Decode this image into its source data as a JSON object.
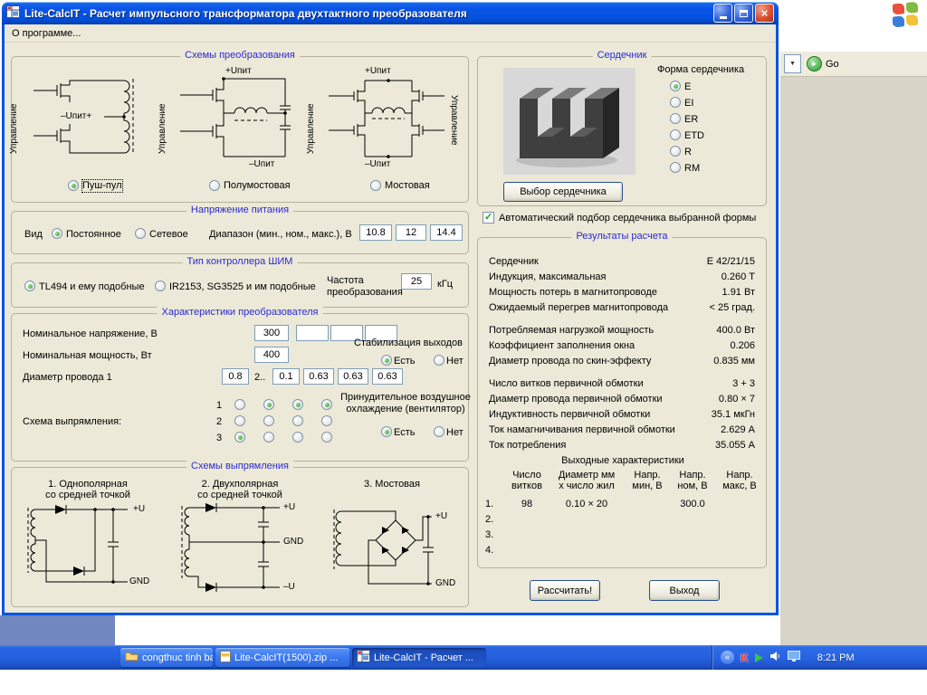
{
  "window": {
    "title": "Lite-CalcIT - Расчет импульсного трансформатора двухтактного преобразователя",
    "menu_about": "О программе..."
  },
  "icons": {
    "close": "×",
    "dropdown_arrow": "▼",
    "tray_chevron": "«",
    "go_arrow": "►",
    "antivirus": "K"
  },
  "background": {
    "go_label": "Go"
  },
  "conversion": {
    "title": "Схемы  преобразования",
    "control_label": "Управление",
    "push_pull_supply": "–Uпит+",
    "supply_plus": "+Uпит",
    "supply_minus": "–Uпит",
    "options": [
      {
        "label": "Пуш-пул",
        "selected": true
      },
      {
        "label": "Полумостовая",
        "selected": false
      },
      {
        "label": "Мостовая",
        "selected": false
      }
    ]
  },
  "supply": {
    "title": "Напряжение питания",
    "kind_label": "Вид",
    "options": [
      {
        "label": "Постоянное",
        "selected": true
      },
      {
        "label": "Сетевое",
        "selected": false
      }
    ],
    "range_label": "Диапазон (мин., ном., макс.), В",
    "values": [
      "10.8",
      "12",
      "14.4"
    ]
  },
  "pwm": {
    "title": "Тип контроллера ШИМ",
    "options": [
      {
        "label": "TL494 и ему подобные",
        "selected": true
      },
      {
        "label": "IR2153, SG3525 и им подобные",
        "selected": false
      }
    ],
    "freq_label_1": "Частота",
    "freq_label_2": "преобразования",
    "freq_value": "25",
    "freq_unit": "кГц"
  },
  "converter": {
    "title": "Характеристики преобразователя",
    "voltage_label": "Номинальное напряжение, В",
    "voltage_1": "300",
    "voltage_2": "",
    "voltage_3": "",
    "voltage_4": "",
    "power_label": "Номинальная мощность, Вт",
    "power_value": "400",
    "diameter_label": "Диаметр провода  1",
    "diameter_1": "0.8",
    "diameter_more_label": "2..",
    "diameter_2": "0.1",
    "diameter_3": "0.63",
    "diameter_4": "0.63",
    "diameter_5": "0.63",
    "stabilization_label": "Стабилизация выходов",
    "yes_label": "Есть",
    "no_label": "Нет",
    "stabilization": {
      "yes": true,
      "no": false
    },
    "cooling_label_1": "Принудительное воздушное",
    "cooling_label_2": "охлаждение (вентилятор)",
    "cooling": {
      "yes": true,
      "no": false
    },
    "rectifier_label": "Схема выпрямления:",
    "row_labels": [
      "1",
      "2",
      "3"
    ],
    "matrix": [
      [
        false,
        true,
        true,
        true
      ],
      [
        false,
        false,
        false,
        false
      ],
      [
        true,
        false,
        false,
        false
      ]
    ]
  },
  "rectifiers": {
    "title": "Схемы выпрямления",
    "scheme1_line1": "1. Однополярная",
    "scheme1_line2": "со средней точкой",
    "scheme2_line1": "2. Двухполярная",
    "scheme2_line2": "со средней точкой",
    "scheme3_line1": "3. Мостовая",
    "plus_u": "+U",
    "gnd": "GND",
    "minus_u": "–U"
  },
  "core": {
    "title": "Сердечник",
    "shape_label": "Форма сердечника",
    "shapes": [
      {
        "label": "E",
        "selected": true
      },
      {
        "label": "EI",
        "selected": false
      },
      {
        "label": "ER",
        "selected": false
      },
      {
        "label": "ETD",
        "selected": false
      },
      {
        "label": "R",
        "selected": false
      },
      {
        "label": "RM",
        "selected": false
      }
    ],
    "select_button": "Выбор сердечника",
    "auto_checked": true,
    "auto_label": "Автоматический подбор сердечника выбранной формы"
  },
  "results": {
    "title": "Результаты расчета",
    "rows": [
      {
        "label": "Сердечник",
        "value": "E 42/21/15"
      },
      {
        "label": "Индукция, максимальная",
        "value": "0.260 Т"
      },
      {
        "label": "Мощность потерь в магнитопроводе",
        "value": "1.91 Вт"
      },
      {
        "label": "Ожидаемый перегрев магнитопровода",
        "value": "< 25 град."
      },
      {
        "label": "Потребляемая нагрузкой мощность",
        "value": "400.0 Вт"
      },
      {
        "label": "Коэффициент заполнения окна",
        "value": "0.206"
      },
      {
        "label": "Диаметр провода по скин-эффекту",
        "value": "0.835 мм"
      },
      {
        "label": "Число витков первичной обмотки",
        "value": "3 + 3"
      },
      {
        "label": "Диаметр провода первичной обмотки",
        "value": "0.80 × 7"
      },
      {
        "label": "Индуктивность первичной обмотки",
        "value": "35.1 мкГн"
      },
      {
        "label": "Ток намагничивания первичной обмотки",
        "value": "2.629 А"
      },
      {
        "label": "Ток потребления",
        "value": "35.055 А"
      }
    ],
    "outputs_title": "Выходные характеристики",
    "col_headers": [
      [
        "Число",
        "витков"
      ],
      [
        "Диаметр мм",
        "х число жил"
      ],
      [
        "Напр.",
        "мин, В"
      ],
      [
        "Напр.",
        "ном, В"
      ],
      [
        "Напр.",
        "макс, В"
      ]
    ],
    "out_rows": [
      {
        "n": "1.",
        "turns": "98",
        "wire": "0.10 × 20",
        "vmin": "",
        "vnom": "300.0",
        "vmax": ""
      },
      {
        "n": "2.",
        "turns": "",
        "wire": "",
        "vmin": "",
        "vnom": "",
        "vmax": ""
      },
      {
        "n": "3.",
        "turns": "",
        "wire": "",
        "vmin": "",
        "vnom": "",
        "vmax": ""
      },
      {
        "n": "4.",
        "turns": "",
        "wire": "",
        "vmin": "",
        "vnom": "",
        "vmax": ""
      }
    ]
  },
  "actions": {
    "calculate": "Рассчитать!",
    "exit": "Выход"
  },
  "taskbar": {
    "buttons": [
      {
        "label": "congthuc tinh bax",
        "active": false
      },
      {
        "label": "Lite-CalcIT(1500).zip ...",
        "active": false
      },
      {
        "label": "Lite-CalcIT - Расчет ...",
        "active": true
      }
    ],
    "clock": "8:21 PM"
  }
}
